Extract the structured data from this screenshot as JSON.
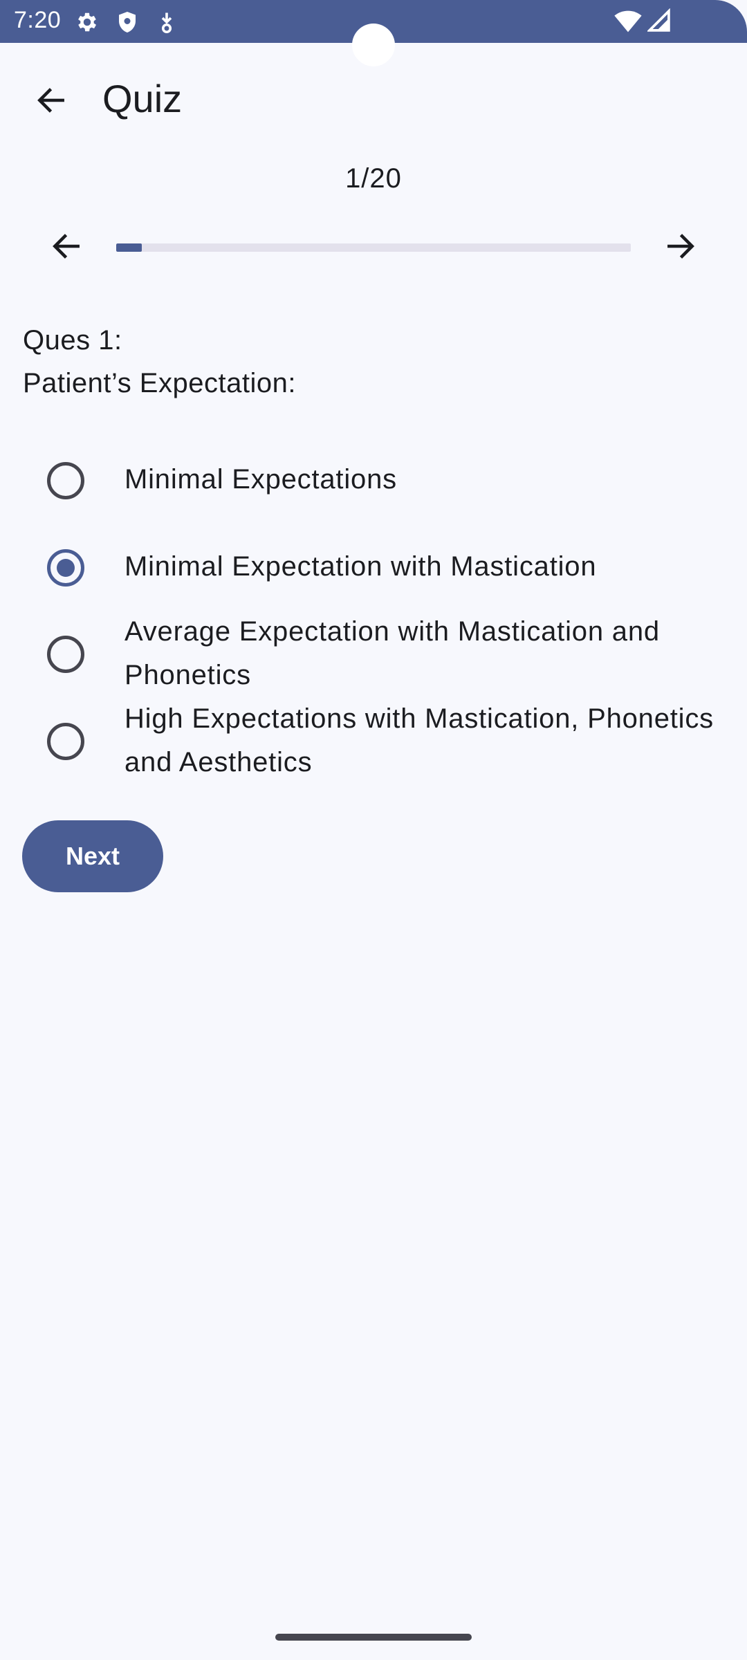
{
  "status_bar": {
    "time": "7:20",
    "left_icons": [
      "gear-icon",
      "shield-icon",
      "download-notification-icon"
    ],
    "right_icons": [
      "wifi-icon",
      "signal-icon"
    ]
  },
  "app_bar": {
    "title": "Quiz",
    "back_icon": "arrow-left-icon"
  },
  "progress": {
    "label": "1/20",
    "current": 1,
    "total": 20
  },
  "question": {
    "number_label": "Ques 1:",
    "text": "Patient’s Expectation:"
  },
  "options": [
    {
      "label": "Minimal Expectations",
      "selected": false
    },
    {
      "label": "Minimal Expectation with Mastication",
      "selected": true
    },
    {
      "label": "Average Expectation with Mastication and Phonetics",
      "selected": false
    },
    {
      "label": "High Expectations with Mastication, Phonetics and Aesthetics",
      "selected": false
    }
  ],
  "next_button": {
    "label": "Next"
  },
  "colors": {
    "primary": "#4a5d94",
    "background": "#f7f8fd",
    "track": "#e3e1ec",
    "text": "#1b1c20"
  }
}
